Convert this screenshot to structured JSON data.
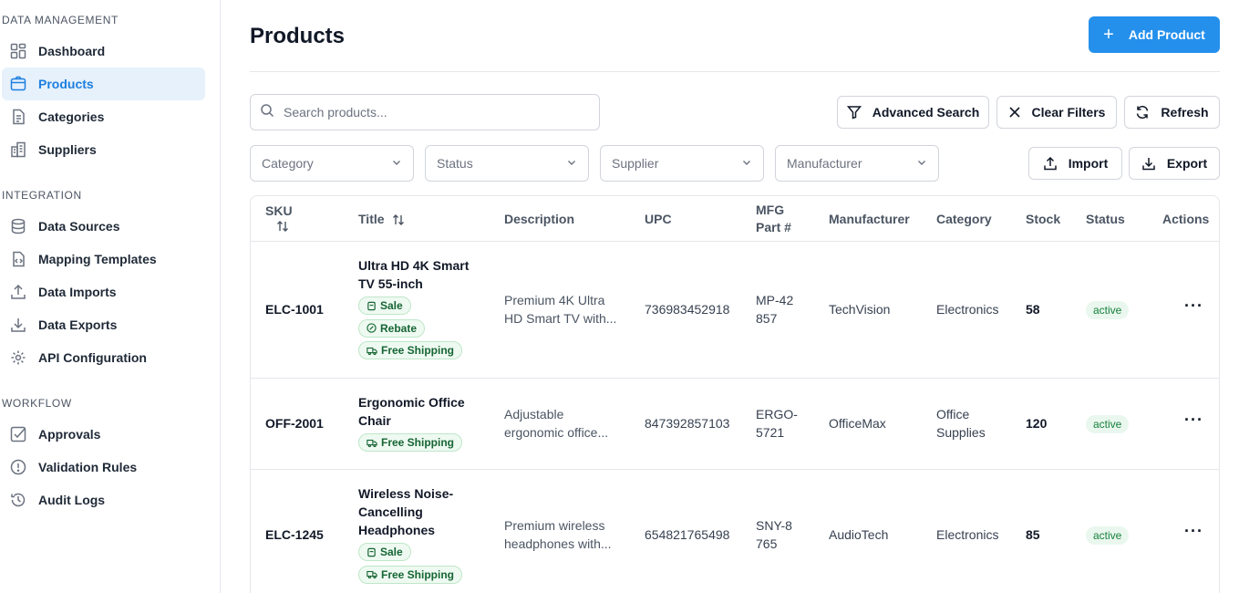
{
  "sidebar": {
    "sections": [
      {
        "title": "DATA MANAGEMENT",
        "items": [
          {
            "label": "Dashboard",
            "icon": "dashboard-icon"
          },
          {
            "label": "Products",
            "icon": "products-icon",
            "active": true
          },
          {
            "label": "Categories",
            "icon": "categories-icon"
          },
          {
            "label": "Suppliers",
            "icon": "suppliers-icon"
          }
        ]
      },
      {
        "title": "INTEGRATION",
        "items": [
          {
            "label": "Data Sources",
            "icon": "database-icon"
          },
          {
            "label": "Mapping Templates",
            "icon": "file-code-icon"
          },
          {
            "label": "Data Imports",
            "icon": "upload-icon"
          },
          {
            "label": "Data Exports",
            "icon": "download-icon"
          },
          {
            "label": "API Configuration",
            "icon": "gear-icon"
          }
        ]
      },
      {
        "title": "WORKFLOW",
        "items": [
          {
            "label": "Approvals",
            "icon": "checkbox-icon"
          },
          {
            "label": "Validation Rules",
            "icon": "alert-circle-icon"
          },
          {
            "label": "Audit Logs",
            "icon": "history-icon"
          }
        ]
      }
    ]
  },
  "header": {
    "title": "Products",
    "add_label": "Add Product"
  },
  "toolbar": {
    "search_placeholder": "Search products...",
    "advanced_search": "Advanced Search",
    "clear_filters": "Clear Filters",
    "refresh": "Refresh",
    "import": "Import",
    "export": "Export"
  },
  "filters": {
    "category": "Category",
    "status": "Status",
    "supplier": "Supplier",
    "manufacturer": "Manufacturer"
  },
  "table": {
    "columns": {
      "sku": "SKU",
      "title": "Title",
      "description": "Description",
      "upc": "UPC",
      "mfg_line1": "MFG",
      "mfg_line2": "Part #",
      "manufacturer": "Manufacturer",
      "category": "Category",
      "stock": "Stock",
      "status": "Status",
      "actions": "Actions"
    },
    "rows": [
      {
        "sku": "ELC-1001",
        "title": "Ultra HD 4K Smart TV 55-inch",
        "tags": [
          "Sale",
          "Rebate",
          "Free Shipping"
        ],
        "description": "Premium 4K Ultra HD Smart TV with...",
        "upc": "736983452918",
        "mfg": "MP-42857",
        "manufacturer": "TechVision",
        "category": "Electronics",
        "stock": "58",
        "status": "active"
      },
      {
        "sku": "OFF-2001",
        "title": "Ergonomic Office Chair",
        "tags": [
          "Free Shipping"
        ],
        "description": "Adjustable ergonomic office...",
        "upc": "847392857103",
        "mfg": "ERGO-5721",
        "manufacturer": "OfficeMax",
        "category": "Office Supplies",
        "stock": "120",
        "status": "active"
      },
      {
        "sku": "ELC-1245",
        "title": "Wireless Noise-Cancelling Headphones",
        "tags": [
          "Sale",
          "Free Shipping"
        ],
        "description": "Premium wireless headphones with...",
        "upc": "654821765498",
        "mfg": "SNY-8765",
        "manufacturer": "AudioTech",
        "category": "Electronics",
        "stock": "85",
        "status": "active"
      }
    ]
  },
  "colors": {
    "accent": "#2590ec",
    "active_bg": "#e6f1fb",
    "status_green": "#16803c"
  }
}
